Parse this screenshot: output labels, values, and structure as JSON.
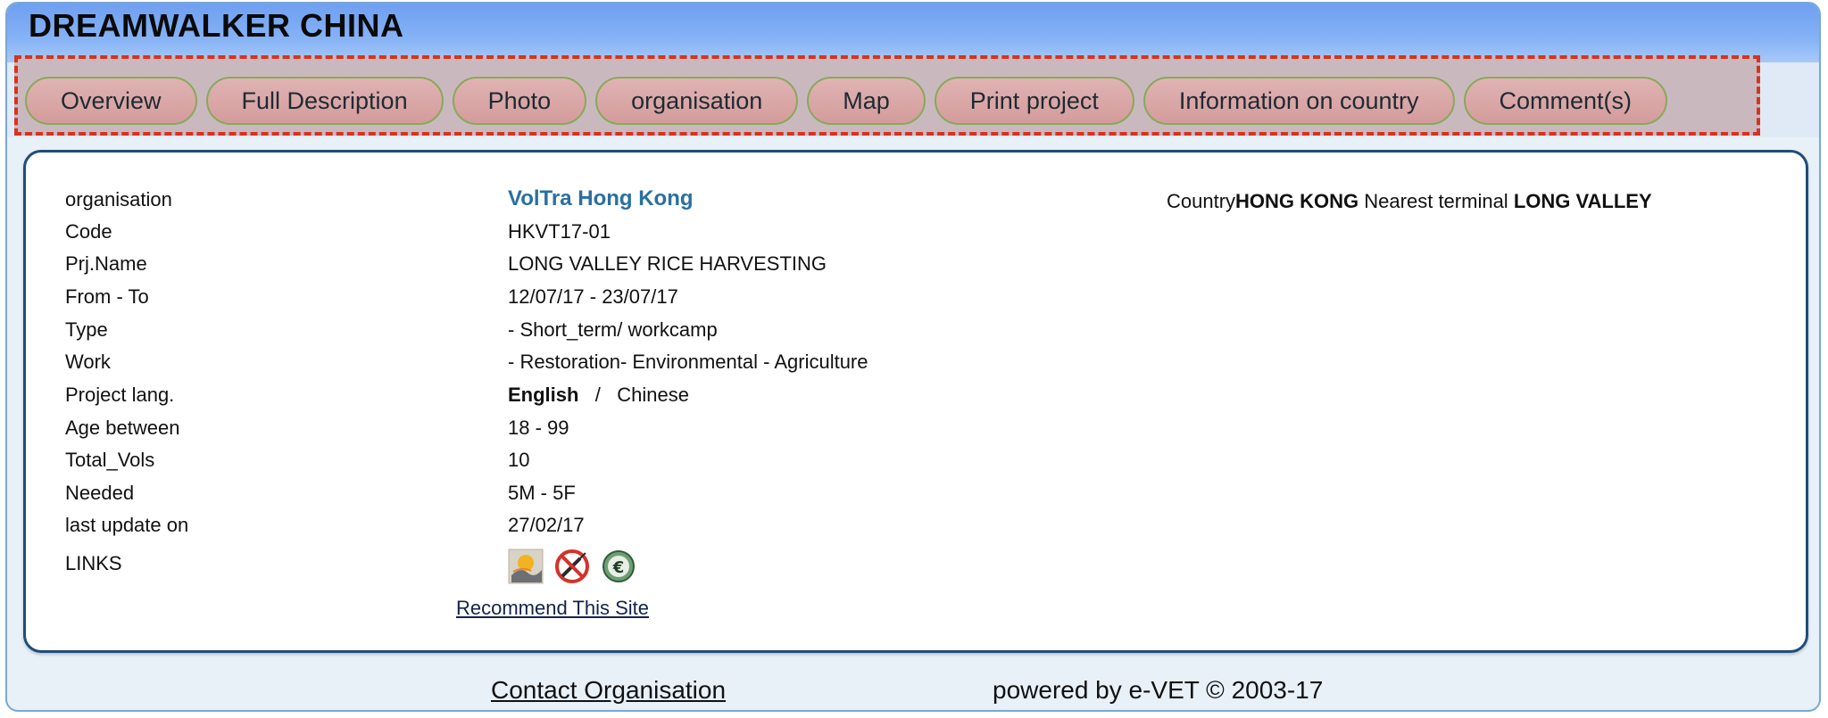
{
  "header": {
    "title": "DREAMWALKER CHINA"
  },
  "tabs": [
    {
      "label": "Overview"
    },
    {
      "label": "Full Description"
    },
    {
      "label": "Photo"
    },
    {
      "label": "organisation"
    },
    {
      "label": "Map"
    },
    {
      "label": "Print project"
    },
    {
      "label": "Information on country"
    },
    {
      "label": "Comment(s)"
    }
  ],
  "details": {
    "organisation": {
      "label": "organisation",
      "value": "VolTra Hong Kong"
    },
    "code": {
      "label": "Code",
      "value": "HKVT17-01"
    },
    "prj_name": {
      "label": "Prj.Name",
      "value": "LONG VALLEY RICE HARVESTING"
    },
    "from_to": {
      "label": "From - To",
      "value": "12/07/17 - 23/07/17"
    },
    "type": {
      "label": "Type",
      "value": "- Short_term/ workcamp"
    },
    "work": {
      "label": "Work",
      "value": "- Restoration- Environmental - Agriculture"
    },
    "project_lang": {
      "label": "Project lang.",
      "primary": "English",
      "separator": "/",
      "secondary": "Chinese"
    },
    "age": {
      "label": "Age between",
      "value": "18 - 99"
    },
    "total_vols": {
      "label": "Total_Vols",
      "value": "10"
    },
    "needed": {
      "label": "Needed",
      "value": "5M - 5F"
    },
    "last_update": {
      "label": "last update on",
      "value": "27/02/17"
    },
    "links": {
      "label": "LINKS"
    }
  },
  "country_info": {
    "country_label": "Country",
    "country_value": "HONG KONG",
    "terminal_label": "Nearest terminal",
    "terminal_value": "LONG VALLEY"
  },
  "links_icons": [
    {
      "icon": "sun-landscape-icon"
    },
    {
      "icon": "no-syringe-icon"
    },
    {
      "icon": "euro-coin-icon"
    }
  ],
  "recommend_link": "Recommend This Site",
  "footer": {
    "contact_label": "Contact Organisation",
    "powered_by": "powered by e-VET © 2003-17"
  },
  "colors": {
    "header_blue": "#86b2f6",
    "tab_fill": "#d49c9c",
    "tab_border": "#8aa85a",
    "highlight_dashed": "#d9311e",
    "org_link": "#2a6fa0",
    "panel_border": "#1f4d7a"
  }
}
